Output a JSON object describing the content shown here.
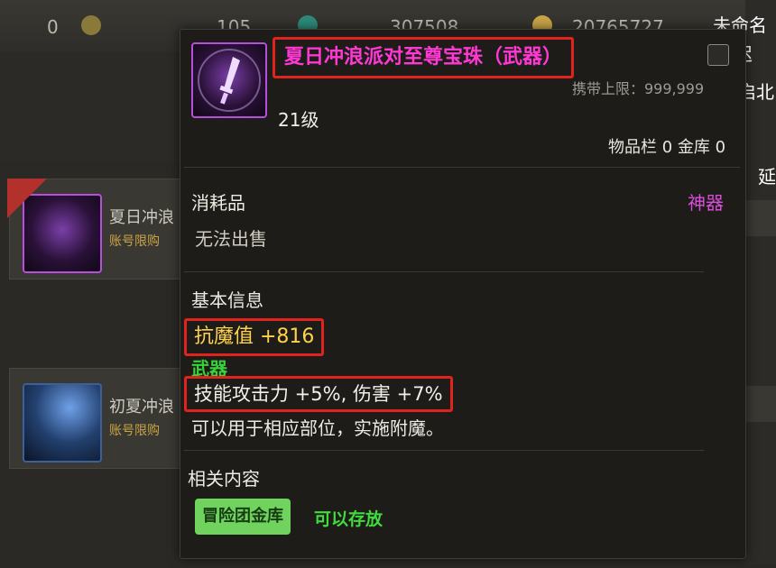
{
  "background": {
    "top_bar": {
      "values": [
        "0",
        "105",
        "307508",
        "20765727"
      ]
    },
    "list": {
      "rows": [
        {
          "title": "夏日冲浪",
          "subtitle": "账号限购"
        },
        {
          "title": "初夏冲浪",
          "subtitle": "账号限购"
        }
      ]
    },
    "right_overlay": {
      "unnamed": "未命名",
      "delay": "延迟",
      "open_north": "开启北",
      "delay_short": "延"
    }
  },
  "tooltip": {
    "title": "夏日冲浪派对至尊宝珠（武器）",
    "carry_limit": "携带上限：999,999",
    "level": "21级",
    "storage": "物品栏 0 金库 0",
    "category": "消耗品",
    "rarity": "神器",
    "no_sell": "无法出售",
    "basic_info_heading": "基本信息",
    "resist_stat": "抗魔值 +816",
    "slot_type": "武器",
    "skill_stat": "技能攻击力 +5%, 伤害 +7%",
    "description": "可以用于相应部位，实施附魔。",
    "related_heading": "相关内容",
    "vault_button": "冒险团金库",
    "storable_label": "可以存放"
  },
  "colors": {
    "title_magenta": "#ff38d4",
    "highlight_red": "#e0241d",
    "resist_yellow": "#ffd24a",
    "weapon_green": "#36d43a",
    "rarity_pink": "#d94ddb",
    "vault_button_green": "#6fd35e"
  }
}
